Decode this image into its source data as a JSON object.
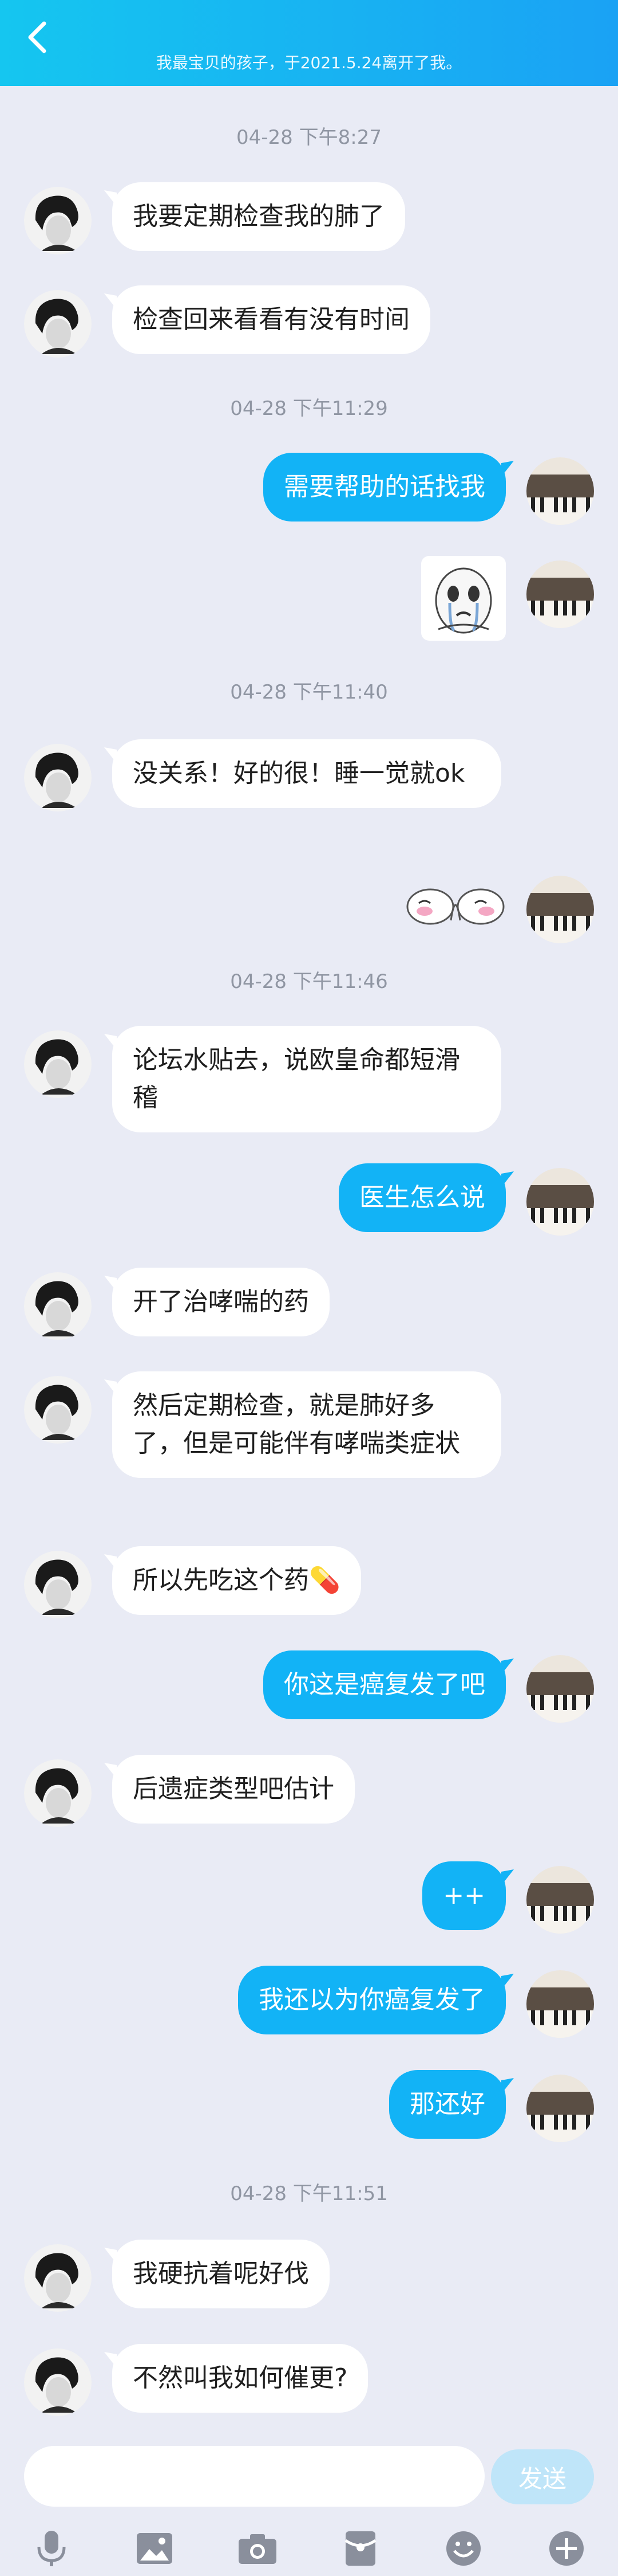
{
  "header": {
    "subtitle": "我最宝贝的孩子，于2021.5.24离开了我。"
  },
  "messages": [
    {
      "type": "timestamp",
      "text": "04-28 下午8:27"
    },
    {
      "type": "text",
      "side": "in",
      "text": "我要定期检查我的肺了"
    },
    {
      "type": "text",
      "side": "in",
      "text": "检查回来看看有没有时间"
    },
    {
      "type": "timestamp",
      "text": "04-28 下午11:29"
    },
    {
      "type": "text",
      "side": "out",
      "text": "需要帮助的话找我"
    },
    {
      "type": "sticker",
      "side": "out",
      "icon": "crying-face-sticker"
    },
    {
      "type": "timestamp",
      "text": "04-28 下午11:40"
    },
    {
      "type": "text",
      "side": "in",
      "text": "没关系！好的很！睡一觉就ok"
    },
    {
      "type": "sticker",
      "side": "out",
      "icon": "shy-blush-sticker"
    },
    {
      "type": "timestamp",
      "text": "04-28 下午11:46"
    },
    {
      "type": "text",
      "side": "in",
      "text": "论坛水贴去，说欧皇命都短滑稽"
    },
    {
      "type": "text",
      "side": "out",
      "text": "医生怎么说"
    },
    {
      "type": "text",
      "side": "in",
      "text": "开了治哮喘的药"
    },
    {
      "type": "text",
      "side": "in",
      "text": "然后定期检查，就是肺好多了，但是可能伴有哮喘类症状"
    },
    {
      "type": "text",
      "side": "in",
      "text": "所以先吃这个药💊"
    },
    {
      "type": "text",
      "side": "out",
      "text": "你这是癌复发了吧"
    },
    {
      "type": "text",
      "side": "in",
      "text": "后遗症类型吧估计"
    },
    {
      "type": "text",
      "side": "out",
      "text": "++"
    },
    {
      "type": "text",
      "side": "out",
      "text": "我还以为你癌复发了"
    },
    {
      "type": "text",
      "side": "out",
      "text": "那还好"
    },
    {
      "type": "timestamp",
      "text": "04-28 下午11:51"
    },
    {
      "type": "text",
      "side": "in",
      "text": "我硬抗着呢好伐"
    },
    {
      "type": "text",
      "side": "in",
      "text": "不然叫我如何催更?"
    }
  ],
  "input": {
    "value": "",
    "send_label": "发送"
  },
  "toolbar": {
    "icons": [
      "microphone-icon",
      "image-icon",
      "camera-icon",
      "red-packet-icon",
      "emoji-icon",
      "plus-icon"
    ]
  },
  "colors": {
    "header_start": "#15c6f0",
    "header_end": "#1aa2f4",
    "bubble_out": "#12b3f6",
    "bubble_in": "#ffffff",
    "background": "#e9ebf5",
    "send_button": "#bfe5f9"
  }
}
